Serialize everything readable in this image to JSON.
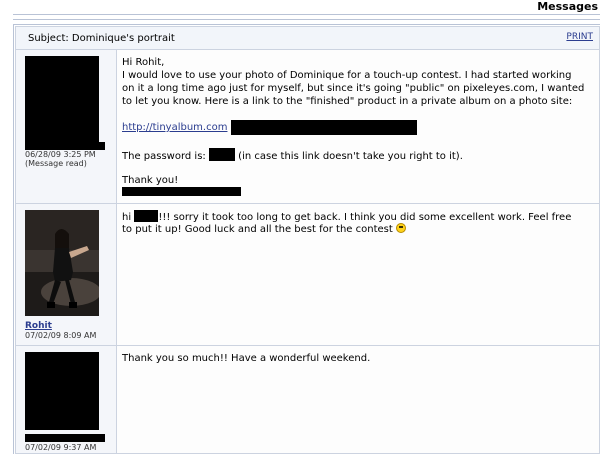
{
  "header": {
    "title": "Messages"
  },
  "thread": {
    "subject": "Subject: Dominique's portrait",
    "print_label": "PRINT"
  },
  "messages": [
    {
      "timestamp": "06/28/09 3:25 PM",
      "status": "(Message read)",
      "greeting": "Hi Rohit,",
      "line1": "I would love to use your photo of Dominique for a touch-up contest. I had started working",
      "line2": "on it a long time ago just for myself, but since it's going \"public\" on pixeleyes.com, I wanted",
      "line3": "to let you know. Here is a link to the \"finished\" product in a private album on a photo site:",
      "link": "http://tinyalbum.com",
      "password_prefix": "The password is:",
      "password_suffix": "(in case this link doesn't take you right to it).",
      "thanks": "Thank you!"
    },
    {
      "username": "Rohit",
      "timestamp": "07/02/09 8:09 AM",
      "prefix": "hi",
      "line1": "!!! sorry it took too long to get back. I think you did some excellent work. Feel free",
      "line2": "to put it up! Good luck and all the best for the contest",
      "emoji": "smiley-icon"
    },
    {
      "timestamp": "07/02/09 9:37 AM",
      "text": "Thank you so much!! Have a wonderful weekend."
    }
  ]
}
